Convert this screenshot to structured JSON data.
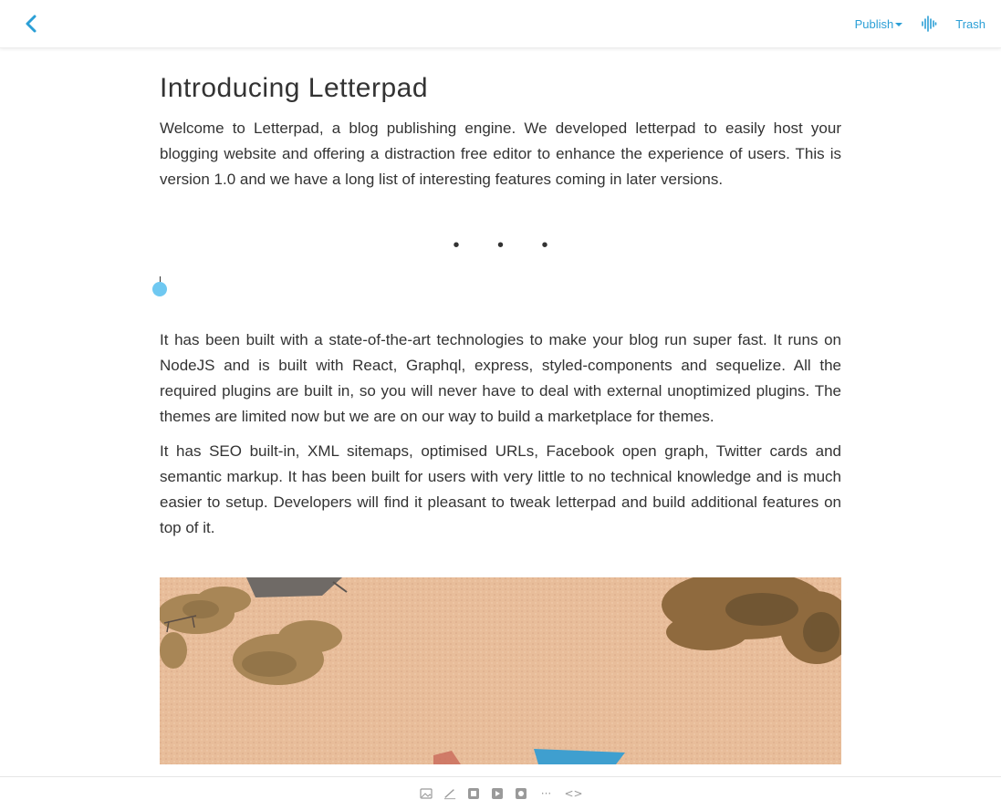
{
  "header": {
    "publish_label": "Publish",
    "trash_label": "Trash",
    "icons": {
      "back": "chevron-left-icon",
      "publish_caret": "caret-down-icon",
      "audio": "audio-wave-icon"
    },
    "accent_color": "#2b9fd6"
  },
  "article": {
    "title": "Introducing Letterpad",
    "paragraphs": [
      "Welcome to Letterpad, a blog publishing engine. We developed letterpad to easily host your blogging website and  offering a distraction free editor to enhance the experience of users. This is version 1.0 and we have a long list of interesting features coming in later versions.",
      "It has been built with a state-of-the-art technologies to make your blog run super fast. It runs on NodeJS and is built with React, Graphql, express, styled-components and sequelize. All the required plugins are built in, so you will never have to deal with external unoptimized plugins. The themes are limited now but we are on our way to build a marketplace for themes.",
      "It has SEO built-in, XML sitemaps, optimised URLs, Facebook open graph, Twitter cards and semantic markup. It has been built for users with very little to no technical knowledge and is much easier to setup. Developers will find it pleasant to tweak letterpad and build additional features on top of it."
    ],
    "separator": "• • •",
    "image": "beach-aerial-image"
  },
  "toolbar": {
    "tools": [
      {
        "icon": "image-icon"
      },
      {
        "icon": "pencil-icon"
      },
      {
        "icon": "block-icon-1"
      },
      {
        "icon": "block-icon-2"
      },
      {
        "icon": "block-icon-3"
      },
      {
        "icon": "separator-dots-icon",
        "glyph": "···"
      },
      {
        "icon": "code-icon",
        "glyph": "<>"
      }
    ]
  }
}
